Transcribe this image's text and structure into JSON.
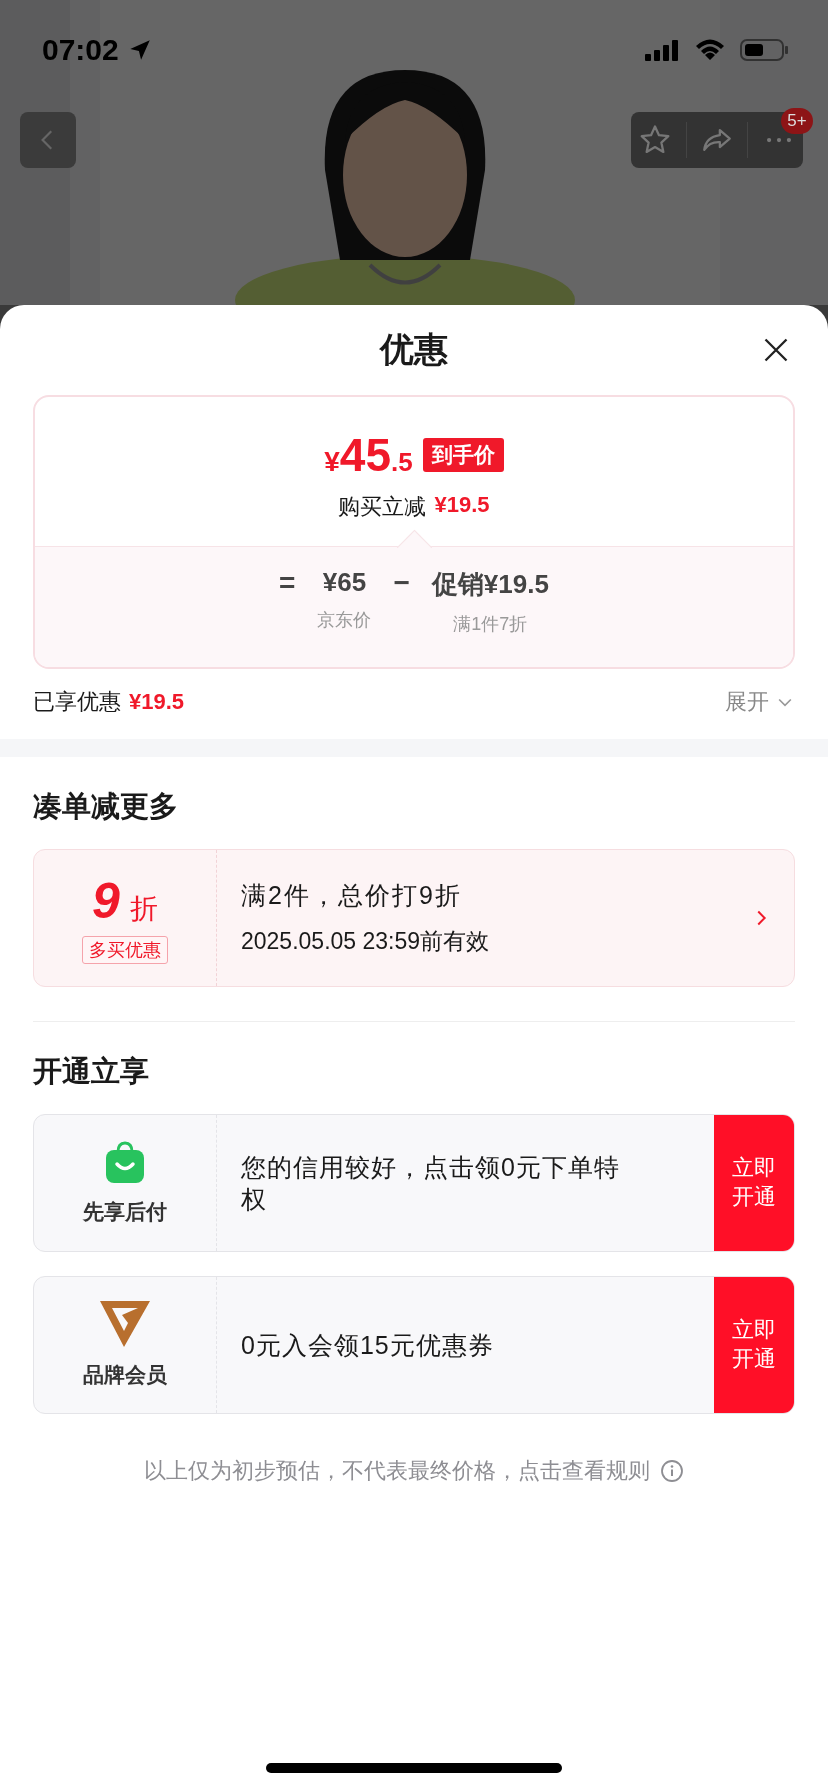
{
  "status_bar": {
    "time": "07:02"
  },
  "nav": {
    "badge": "5+"
  },
  "sheet": {
    "title": "优惠"
  },
  "price_card": {
    "currency": "¥",
    "price_main": "45",
    "price_decimal": ".5",
    "price_tag": "到手价",
    "reduction_label": "购买立减",
    "reduction_amount": "¥19.5",
    "equals": "=",
    "base_price": "¥65",
    "base_label": "京东价",
    "minus": "−",
    "promo": "促销¥19.5",
    "promo_label": "满1件7折"
  },
  "enjoyed": {
    "label": "已享优惠",
    "amount": "¥19.5",
    "expand": "展开"
  },
  "bundle": {
    "title": "凑单减更多",
    "coupon": {
      "discount": "9",
      "unit": "折",
      "tag": "多买优惠",
      "rule": "满2件，总价打9折",
      "validity": "2025.05.05 23:59前有效"
    }
  },
  "membership": {
    "title": "开通立享",
    "offers": [
      {
        "kind": "bag",
        "name": "先享后付",
        "text": "您的信用较好，点击领0元下单特权",
        "action": "立即开通"
      },
      {
        "kind": "v-logo",
        "name": "品牌会员",
        "text": "0元入会领15元优惠券",
        "action": "立即开通"
      }
    ]
  },
  "footer": {
    "note": "以上仅为初步预估，不代表最终价格，点击查看规则"
  }
}
